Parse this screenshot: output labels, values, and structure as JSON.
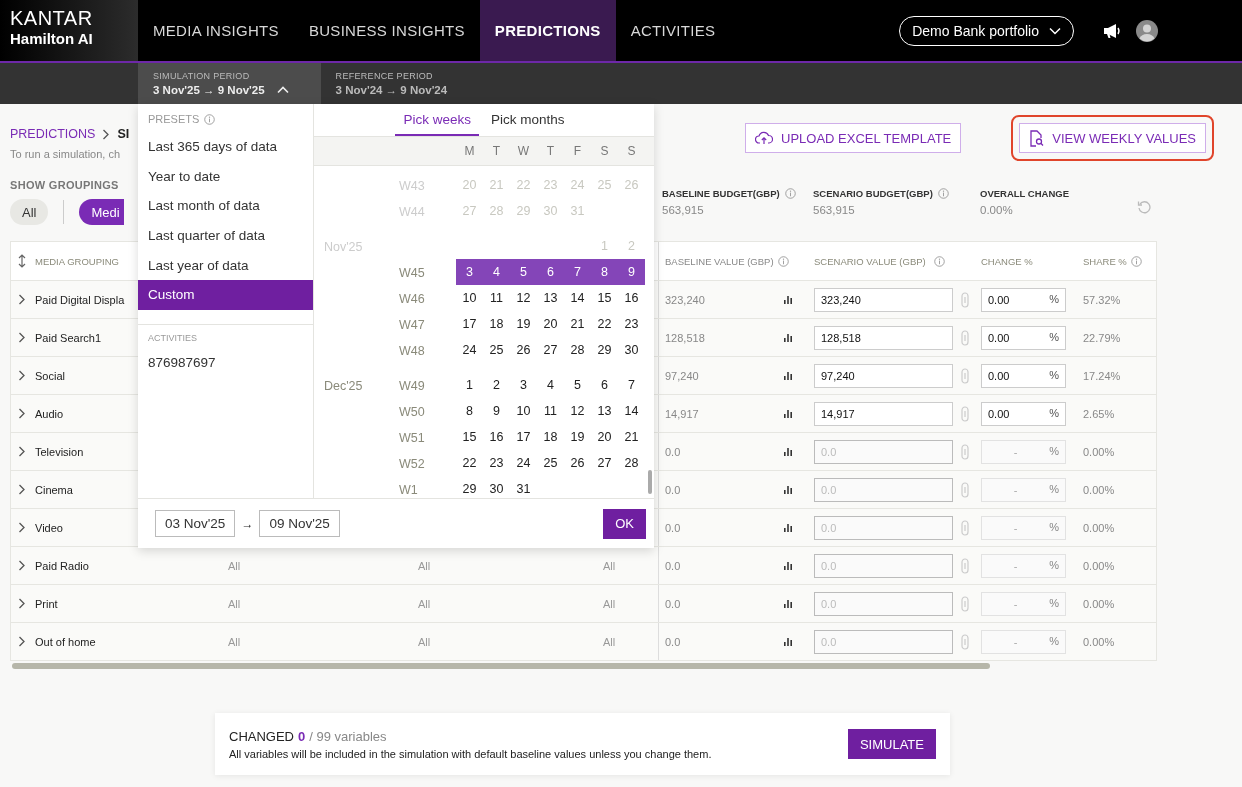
{
  "header": {
    "logo": {
      "brand": "KANTAR",
      "product": "Hamilton AI"
    },
    "nav": [
      {
        "label": "MEDIA INSIGHTS",
        "selected": false
      },
      {
        "label": "BUSINESS INSIGHTS",
        "selected": false
      },
      {
        "label": "PREDICTIONS",
        "selected": true
      },
      {
        "label": "ACTIVITIES",
        "selected": false
      }
    ],
    "portfolio": "Demo Bank portfolio"
  },
  "periods": [
    {
      "label": "SIMULATION PERIOD",
      "range": "3 Nov'25 → 9 Nov'25",
      "expanded": true
    },
    {
      "label": "REFERENCE PERIOD",
      "range": "3 Nov'24 → 9 Nov'24",
      "expanded": false
    }
  ],
  "breadcrumb": {
    "parent": "PREDICTIONS",
    "current": "SI"
  },
  "subtitle": "To run a simulation, ch",
  "groupings": {
    "label": "SHOW GROUPINGS",
    "chips": [
      {
        "label": "All",
        "selected": false
      },
      {
        "label": "Medi",
        "selected": true
      }
    ]
  },
  "actions": [
    {
      "label": "UPLOAD EXCEL TEMPLATE",
      "kind": "upload",
      "highlighted": false
    },
    {
      "label": "VIEW WEEKLY VALUES",
      "kind": "view",
      "highlighted": true
    }
  ],
  "summary": [
    {
      "label": "BASELINE BUDGET(GBP)",
      "value": "563,915",
      "info": true
    },
    {
      "label": "SCENARIO BUDGET(GBP)",
      "value": "563,915",
      "info": true
    },
    {
      "label": "OVERALL CHANGE",
      "value": "0.00%",
      "info": false
    }
  ],
  "table": {
    "columns": [
      {
        "label": "MEDIA GROUPING",
        "kind": "grouping",
        "info": false
      },
      {
        "label": "BASELINE VALUE (GBP)",
        "kind": "baseline",
        "info": true
      },
      {
        "label": "SCENARIO VALUE (GBP)",
        "kind": "scenario",
        "info": true
      },
      {
        "label": "CHANGE %",
        "kind": "change",
        "info": false
      },
      {
        "label": "SHARE %",
        "kind": "share",
        "info": true
      }
    ],
    "rows": [
      {
        "name": "Paid Digital Displa",
        "baseline_value": "323,240",
        "scenario_value": "323,240",
        "change": "0.00",
        "unit": "%",
        "share": "57.32%",
        "disabled": false
      },
      {
        "name": "Paid Search1",
        "baseline_value": "128,518",
        "scenario_value": "128,518",
        "change": "0.00",
        "unit": "%",
        "share": "22.79%",
        "disabled": false
      },
      {
        "name": "Social",
        "baseline_value": "97,240",
        "scenario_value": "97,240",
        "change": "0.00",
        "unit": "%",
        "share": "17.24%",
        "disabled": false
      },
      {
        "name": "Audio",
        "baseline_value": "14,917",
        "scenario_value": "14,917",
        "change": "0.00",
        "unit": "%",
        "share": "2.65%",
        "disabled": false
      },
      {
        "name": "Television",
        "baseline_value": "0.0",
        "scenario_value": "0.0",
        "change": "-",
        "unit": "%",
        "share": "0.00%",
        "disabled": true
      },
      {
        "name": "Cinema",
        "baseline_value": "0.0",
        "scenario_value": "0.0",
        "change": "-",
        "unit": "%",
        "share": "0.00%",
        "disabled": true
      },
      {
        "name": "Video",
        "baseline_value": "0.0",
        "scenario_value": "0.0",
        "change": "-",
        "unit": "%",
        "share": "0.00%",
        "disabled": true
      },
      {
        "name": "Paid Radio",
        "column_2": "All",
        "column_3": "All",
        "column_4": "All",
        "baseline_value": "0.0",
        "scenario_value": "0.0",
        "change": "-",
        "unit": "%",
        "share": "0.00%",
        "disabled": true
      },
      {
        "name": "Print",
        "column_2": "All",
        "column_3": "All",
        "column_4": "All",
        "baseline_value": "0.0",
        "scenario_value": "0.0",
        "change": "-",
        "unit": "%",
        "share": "0.00%",
        "disabled": true
      },
      {
        "name": "Out of home",
        "column_2": "All",
        "column_3": "All",
        "column_4": "All",
        "baseline_value": "0.0",
        "scenario_value": "0.0",
        "change": "-",
        "unit": "%",
        "share": "0.00%",
        "disabled": true
      }
    ]
  },
  "dropdown": {
    "presets_label": "PRESETS",
    "presets": [
      {
        "label": "Last 365 days of data",
        "selected": false
      },
      {
        "label": "Year to date",
        "selected": false
      },
      {
        "label": "Last month of data",
        "selected": false
      },
      {
        "label": "Last quarter of data",
        "selected": false
      },
      {
        "label": "Last year of data",
        "selected": false
      },
      {
        "label": "Custom",
        "selected": true
      }
    ],
    "activities_label": "ACTIVITIES",
    "activities": [
      "876987697"
    ],
    "tabs": [
      {
        "label": "Pick weeks",
        "selected": true
      },
      {
        "label": "Pick months",
        "selected": false
      }
    ],
    "weekdays": [
      "M",
      "T",
      "W",
      "T",
      "F",
      "S",
      "S"
    ],
    "weeks": [
      {
        "week": "W43",
        "days": [
          "20",
          "21",
          "22",
          "23",
          "24",
          "25",
          "26"
        ],
        "disabled": true,
        "selected": false
      },
      {
        "week": "W44",
        "days": [
          "27",
          "28",
          "29",
          "30",
          "31"
        ],
        "disabled": true,
        "selected": false
      },
      {
        "month": "Nov'25",
        "days": [
          "1",
          "2"
        ],
        "disabled": true,
        "selected": false
      },
      {
        "week": "W45",
        "days": [
          "3",
          "4",
          "5",
          "6",
          "7",
          "8",
          "9"
        ],
        "disabled": false,
        "selected": true
      },
      {
        "week": "W46",
        "days": [
          "10",
          "11",
          "12",
          "13",
          "14",
          "15",
          "16"
        ],
        "disabled": false,
        "selected": false
      },
      {
        "week": "W47",
        "days": [
          "17",
          "18",
          "19",
          "20",
          "21",
          "22",
          "23"
        ],
        "disabled": false,
        "selected": false
      },
      {
        "week": "W48",
        "days": [
          "24",
          "25",
          "26",
          "27",
          "28",
          "29",
          "30"
        ],
        "disabled": false,
        "selected": false
      },
      {
        "month": "Dec'25",
        "week": "W49",
        "days": [
          "1",
          "2",
          "3",
          "4",
          "5",
          "6",
          "7"
        ],
        "disabled": false,
        "selected": false
      },
      {
        "week": "W50",
        "days": [
          "8",
          "9",
          "10",
          "11",
          "12",
          "13",
          "14"
        ],
        "disabled": false,
        "selected": false
      },
      {
        "week": "W51",
        "days": [
          "15",
          "16",
          "17",
          "18",
          "19",
          "20",
          "21"
        ],
        "disabled": false,
        "selected": false
      },
      {
        "week": "W52",
        "days": [
          "22",
          "23",
          "24",
          "25",
          "26",
          "27",
          "28"
        ],
        "disabled": false,
        "selected": false
      },
      {
        "week": "W1",
        "days": [
          "29",
          "30",
          "31"
        ],
        "disabled": false,
        "selected": false
      }
    ],
    "from": "03 Nov'25",
    "arrow": "→",
    "to": "09 Nov'25",
    "ok": "OK"
  },
  "footer": {
    "changed_label": "CHANGED",
    "changed_count": "0",
    "changed_total": "/ 99 variables",
    "note": "All variables will be included in the simulation with default baseline values unless you change them.",
    "button": "SIMULATE"
  }
}
